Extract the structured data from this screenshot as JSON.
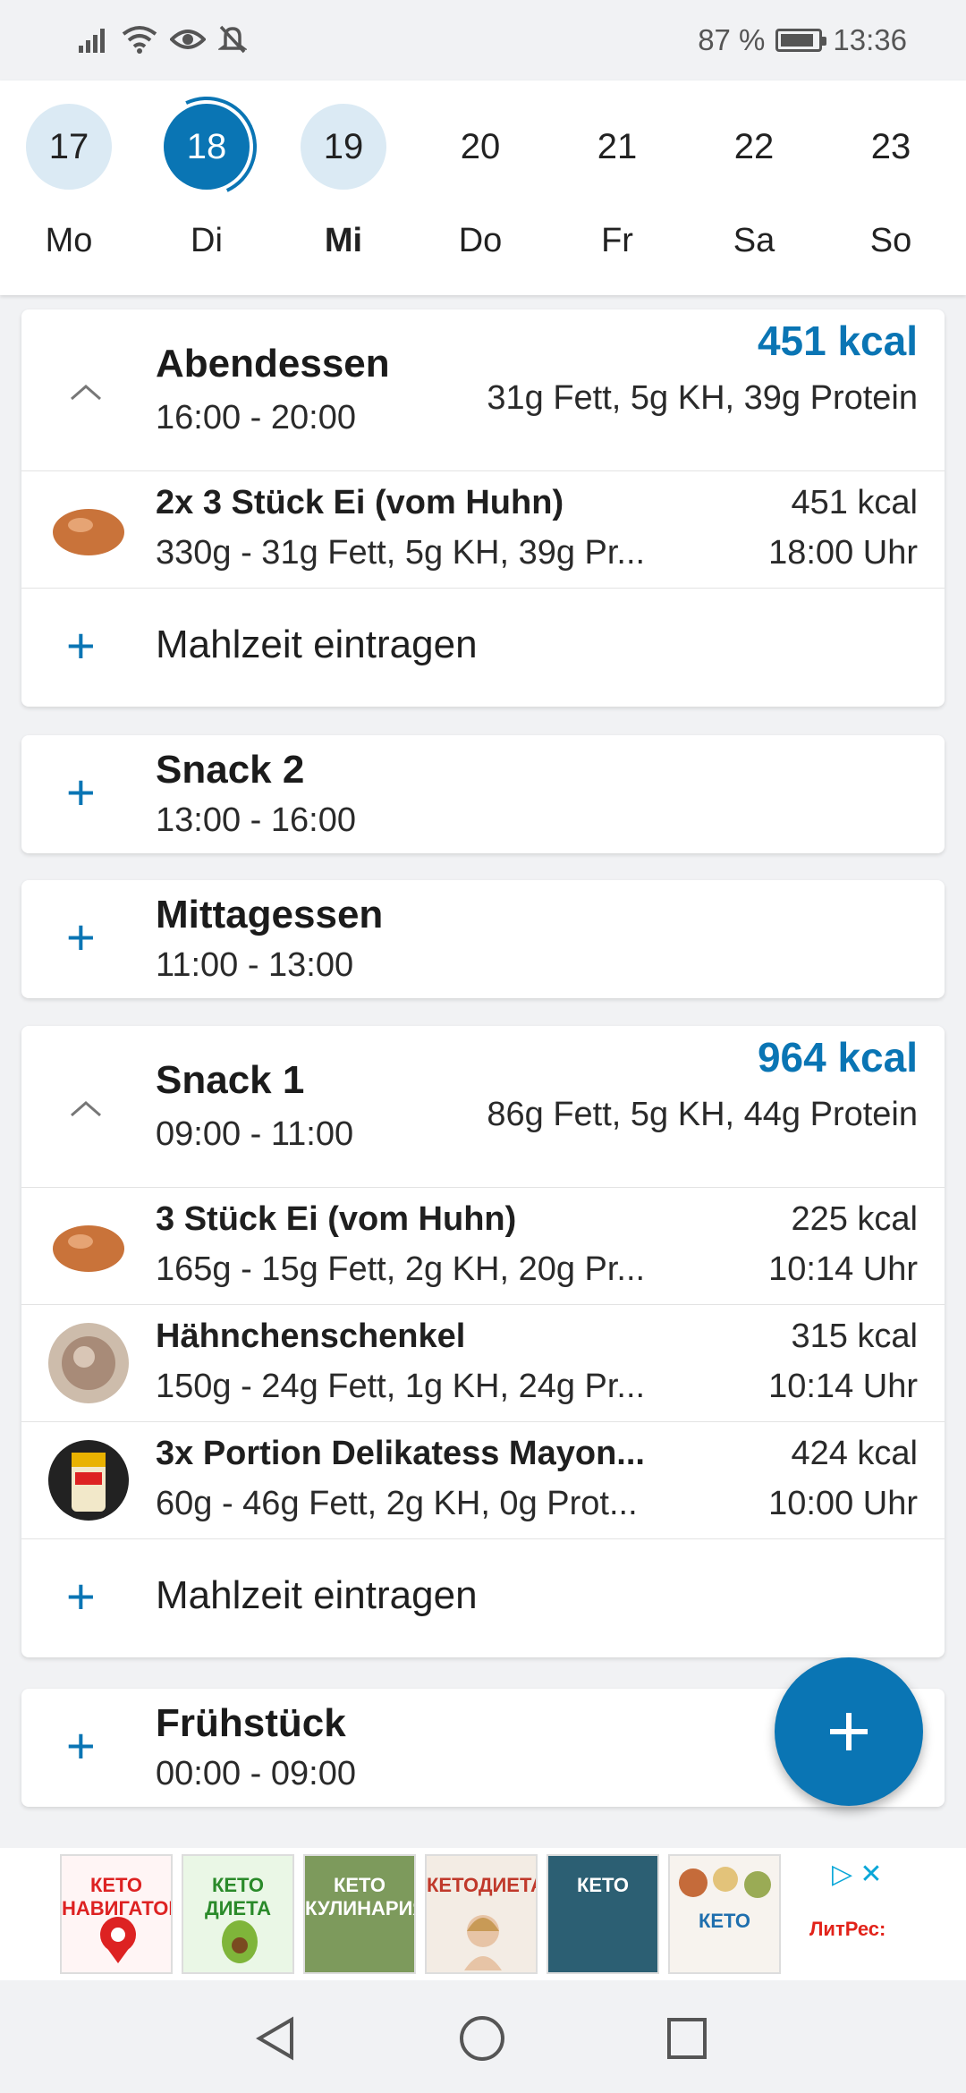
{
  "status_bar": {
    "battery": "87 %",
    "time": "13:36"
  },
  "calendar": [
    {
      "num": "17",
      "day": "Mo",
      "style": "light"
    },
    {
      "num": "18",
      "day": "Di",
      "style": "selected"
    },
    {
      "num": "19",
      "day": "Mi",
      "style": "light",
      "bold": true
    },
    {
      "num": "20",
      "day": "Do"
    },
    {
      "num": "21",
      "day": "Fr"
    },
    {
      "num": "22",
      "day": "Sa"
    },
    {
      "num": "23",
      "day": "So"
    }
  ],
  "meals": {
    "abendessen": {
      "title": "Abendessen",
      "time": "16:00 - 20:00",
      "kcal": "451 kcal",
      "macros": "31g Fett, 5g KH, 39g Protein",
      "entries": [
        {
          "name": "2x 3 Stück Ei (vom Huhn)",
          "detail": "330g - 31g Fett, 5g KH, 39g Pr...",
          "kcal": "451 kcal",
          "time": "18:00 Uhr",
          "thumb": "egg"
        }
      ],
      "add_label": "Mahlzeit eintragen"
    },
    "snack2": {
      "title": "Snack 2",
      "time": "13:00 - 16:00"
    },
    "mittagessen": {
      "title": "Mittagessen",
      "time": "11:00 - 13:00"
    },
    "snack1": {
      "title": "Snack 1",
      "time": "09:00 - 11:00",
      "kcal": "964 kcal",
      "macros": "86g Fett, 5g KH, 44g Protein",
      "entries": [
        {
          "name": "3 Stück Ei (vom Huhn)",
          "detail": "165g - 15g Fett, 2g KH, 20g Pr...",
          "kcal": "225 kcal",
          "time": "10:14 Uhr",
          "thumb": "egg"
        },
        {
          "name": "Hähnchenschenkel",
          "detail": "150g - 24g Fett, 1g KH, 24g Pr...",
          "kcal": "315 kcal",
          "time": "10:14 Uhr",
          "thumb": "chicken"
        },
        {
          "name": "3x Portion Delikatess Mayon...",
          "detail": "60g - 46g Fett, 2g KH, 0g Prot...",
          "kcal": "424 kcal",
          "time": "10:00 Uhr",
          "thumb": "mayo"
        }
      ],
      "add_label": "Mahlzeit eintragen"
    },
    "fruehstueck": {
      "title": "Frühstück",
      "time": "00:00 - 09:00"
    }
  },
  "ad": {
    "books": [
      "КЕТО НАВИГАТОР",
      "КЕТО ДИЕТА",
      "КЕТО КУЛИНАРИЯ",
      "КЕТОДИЕТА",
      "КЕТО",
      "КЕТО"
    ],
    "brand": "ЛитРес:"
  },
  "colors": {
    "accent": "#0a75b4",
    "highlight": "#dbeaf4"
  }
}
